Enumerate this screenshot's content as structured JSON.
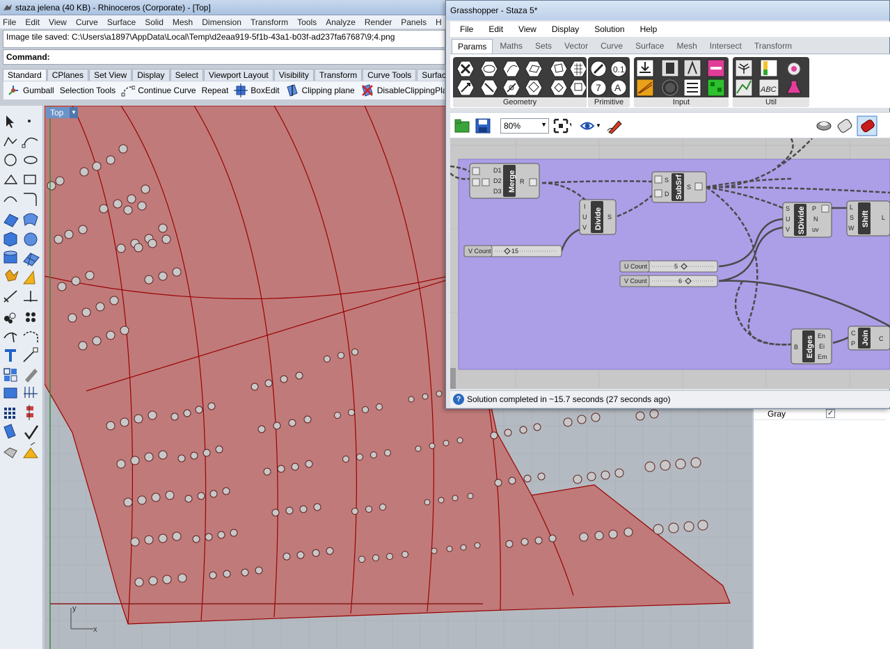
{
  "rhino": {
    "title": "staza jelena (40 KB) - Rhinoceros (Corporate) - [Top]",
    "menu": [
      "File",
      "Edit",
      "View",
      "Curve",
      "Surface",
      "Solid",
      "Mesh",
      "Dimension",
      "Transform",
      "Tools",
      "Analyze",
      "Render",
      "Panels",
      "H"
    ],
    "command_history": "Image tile saved: C:\\Users\\a1897\\AppData\\Local\\Temp\\d2eaa919-5f1b-43a1-b03f-ad237fa67687\\9;4.png",
    "command_prompt": "Command:",
    "toolbar_tabs": [
      "Standard",
      "CPlanes",
      "Set View",
      "Display",
      "Select",
      "Viewport Layout",
      "Visibility",
      "Transform",
      "Curve Tools",
      "Surface To"
    ],
    "toolbar_commands": [
      "Gumball",
      "Selection Tools",
      "Continue Curve",
      "Repeat",
      "BoxEdit",
      "Clipping plane",
      "DisableClippingPla"
    ],
    "viewport_name": "Top",
    "axis_x": "x",
    "axis_y": "y",
    "panel_row_label": "Gray",
    "panel_row_checked": true,
    "colors": {
      "surface_fill": "#c07a7a",
      "surface_edge": "#9a0000",
      "viewport_bg": "#b4bac1",
      "grid_line": "#a8aeb5"
    }
  },
  "grasshopper": {
    "title": "Grasshopper - Staza 5*",
    "menu": [
      "File",
      "Edit",
      "View",
      "Display",
      "Solution",
      "Help"
    ],
    "tabs": [
      "Params",
      "Maths",
      "Sets",
      "Vector",
      "Curve",
      "Surface",
      "Mesh",
      "Intersect",
      "Transform"
    ],
    "active_tab": "Params",
    "ribbon_groups": [
      "Geometry",
      "Primitive",
      "Input",
      "Util"
    ],
    "zoom": "80%",
    "status": "Solution completed in ~15.7 seconds (27 seconds ago)",
    "components": {
      "merge": {
        "name": "Merge",
        "inputs": [
          "D1",
          "D2",
          "D3"
        ],
        "outputs": [
          "R"
        ]
      },
      "divide": {
        "name": "Divide",
        "inputs": [
          "I",
          "U",
          "V"
        ],
        "outputs": [
          "S"
        ]
      },
      "subsrf": {
        "name": "SubSrf",
        "inputs": [
          "S",
          "D"
        ],
        "outputs": [
          "S"
        ]
      },
      "sdivide": {
        "name": "SDivide",
        "inputs": [
          "S",
          "U",
          "V"
        ],
        "outputs": [
          "P",
          "N",
          "uv"
        ]
      },
      "shift": {
        "name": "Shift",
        "inputs": [
          "L",
          "S",
          "W"
        ],
        "outputs": [
          "L"
        ]
      },
      "edges": {
        "name": "Edges",
        "inputs": [
          "B"
        ],
        "outputs": [
          "En",
          "Ei",
          "Em"
        ]
      },
      "join": {
        "name": "Join",
        "inputs": [
          "C",
          "P"
        ],
        "outputs": [
          "C"
        ]
      }
    },
    "sliders": [
      {
        "label": "V Count",
        "value": "15"
      },
      {
        "label": "U Count",
        "value": "5"
      },
      {
        "label": "V Count",
        "value": "6"
      }
    ],
    "colors": {
      "group_fill": "#ad9ee8",
      "component": "#4a4a4a",
      "wire": "#4a4a4a"
    }
  }
}
